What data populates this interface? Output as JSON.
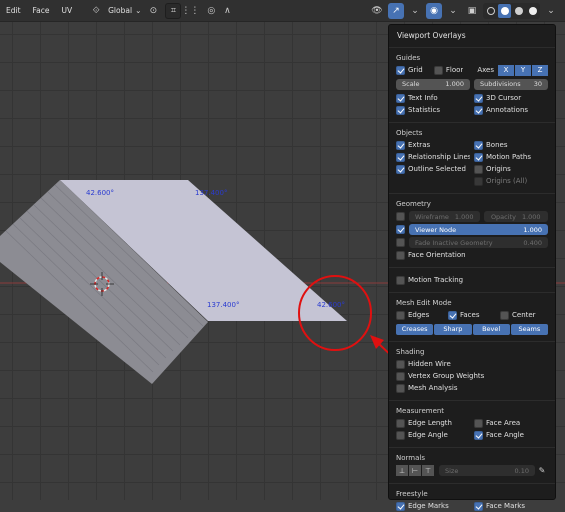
{
  "header": {
    "menus": [
      "Edit",
      "Face",
      "UV"
    ],
    "orientation": "Global"
  },
  "viewport": {
    "angle_labels": [
      "42.600°",
      "137.400°",
      "137.400°",
      "42.600°"
    ]
  },
  "panel": {
    "title": "Viewport Overlays",
    "guides": {
      "title": "Guides",
      "grid": "Grid",
      "floor": "Floor",
      "axes": "Axes",
      "axis_x": "X",
      "axis_y": "Y",
      "axis_z": "Z",
      "scale_label": "Scale",
      "scale_value": "1.000",
      "subdivisions_label": "Subdivisions",
      "subdivisions_value": "30",
      "text_info": "Text Info",
      "cursor_3d": "3D Cursor",
      "statistics": "Statistics",
      "annotations": "Annotations"
    },
    "objects": {
      "title": "Objects",
      "extras": "Extras",
      "bones": "Bones",
      "relationship_lines": "Relationship Lines",
      "motion_paths": "Motion Paths",
      "outline_selected": "Outline Selected",
      "origins": "Origins",
      "origins_all": "Origins (All)"
    },
    "geometry": {
      "title": "Geometry",
      "wireframe_label": "Wireframe",
      "wireframe_value": "1.000",
      "opacity_label": "Opacity",
      "opacity_value": "1.000",
      "viewer_node": "Viewer Node",
      "viewer_value": "1.000",
      "fade_inactive": "Fade Inactive Geometry",
      "fade_value": "0.400",
      "face_orientation": "Face Orientation"
    },
    "motion_tracking": "Motion Tracking",
    "mesh_edit": {
      "title": "Mesh Edit Mode",
      "edges": "Edges",
      "faces": "Faces",
      "center": "Center",
      "creases": "Creases",
      "sharp": "Sharp",
      "bevel": "Bevel",
      "seams": "Seams"
    },
    "shading": {
      "title": "Shading",
      "hidden_wire": "Hidden Wire",
      "vertex_group_weights": "Vertex Group Weights",
      "mesh_analysis": "Mesh Analysis"
    },
    "measurement": {
      "title": "Measurement",
      "edge_length": "Edge Length",
      "face_area": "Face Area",
      "edge_angle": "Edge Angle",
      "face_angle": "Face Angle"
    },
    "normals": {
      "title": "Normals",
      "size_label": "Size",
      "size_value": "0.10"
    },
    "freestyle": {
      "title": "Freestyle",
      "edge_marks": "Edge Marks",
      "face_marks": "Face Marks"
    }
  },
  "colors": {
    "accent": "#4772b3",
    "annotation_red": "#e01010",
    "angle_text": "#2a3bd0"
  }
}
